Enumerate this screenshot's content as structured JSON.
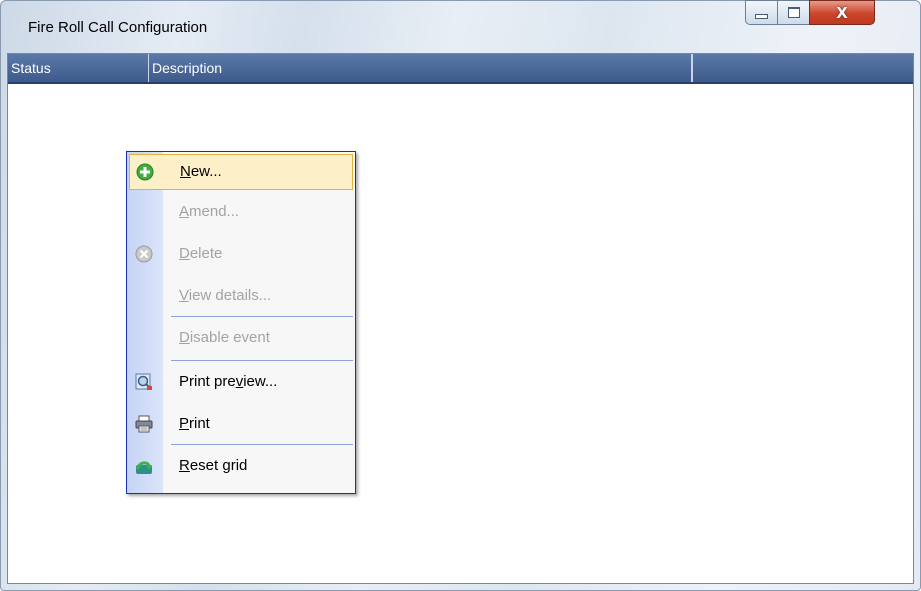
{
  "window": {
    "title": "Fire Roll Call Configuration",
    "controls": {
      "minimize": "minimize",
      "maximize": "maximize",
      "close": "X"
    }
  },
  "grid": {
    "columns": [
      "Status",
      "Description",
      ""
    ]
  },
  "context_menu": {
    "items": [
      {
        "pre": "",
        "ul": "N",
        "post": "ew...",
        "enabled": true,
        "icon": "green-plus-icon",
        "highlighted": true
      },
      {
        "pre": "",
        "ul": "A",
        "post": "mend...",
        "enabled": false,
        "icon": ""
      },
      {
        "pre": "",
        "ul": "D",
        "post": "elete",
        "enabled": false,
        "icon": "grey-x-circle-icon"
      },
      {
        "pre": "",
        "ul": "V",
        "post": "iew details...",
        "enabled": false,
        "icon": ""
      },
      {
        "pre": "",
        "ul": "D",
        "post": "isable event",
        "enabled": false,
        "icon": ""
      },
      {
        "pre": "Print pre",
        "ul": "v",
        "post": "iew...",
        "enabled": true,
        "icon": "print-preview-icon"
      },
      {
        "pre": "",
        "ul": "P",
        "post": "rint",
        "enabled": true,
        "icon": "printer-icon"
      },
      {
        "pre": "",
        "ul": "R",
        "post": "eset grid",
        "enabled": true,
        "icon": "reset-arrow-icon"
      }
    ]
  },
  "colors": {
    "header": "#3d5a8c",
    "menu_border": "#1a2fb0",
    "highlight": "#fdf0c8",
    "disabled_text": "#a3a3a3"
  }
}
